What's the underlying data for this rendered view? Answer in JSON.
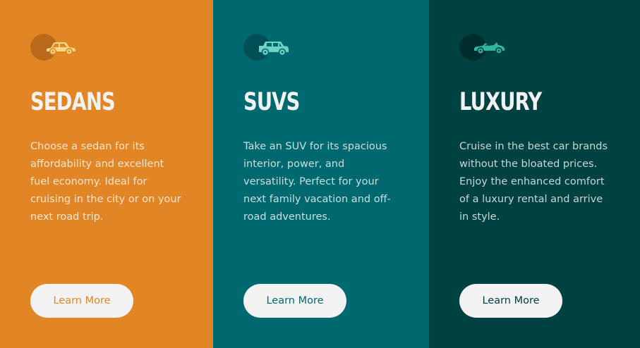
{
  "cards": [
    {
      "id": "sedans",
      "title": "SEDANS",
      "description": "Choose a sedan for its affordability and excellent fuel economy. Ideal for cruising in the city or on your next road trip.",
      "button_label": "Learn More",
      "icon": "sedan-car-icon",
      "bg_color": "#e28625",
      "icon_color": "#f8d98a",
      "button_text_color": "#e28625"
    },
    {
      "id": "suvs",
      "title": "SUVS",
      "description": "Take an SUV for its spacious interior, power, and versatility. Perfect for your next family vacation and off-road adventures.",
      "button_label": "Learn More",
      "icon": "suv-car-icon",
      "bg_color": "#006970",
      "icon_color": "#6fd3c4",
      "button_text_color": "#006970"
    },
    {
      "id": "luxury",
      "title": "LUXURY",
      "description": "Cruise in the best car brands without the bloated prices. Enjoy the enhanced comfort of a luxury rental and arrive in style.",
      "button_label": "Learn More",
      "icon": "luxury-car-icon",
      "bg_color": "#004141",
      "icon_color": "#2fb89e",
      "button_text_color": "#004141"
    }
  ]
}
